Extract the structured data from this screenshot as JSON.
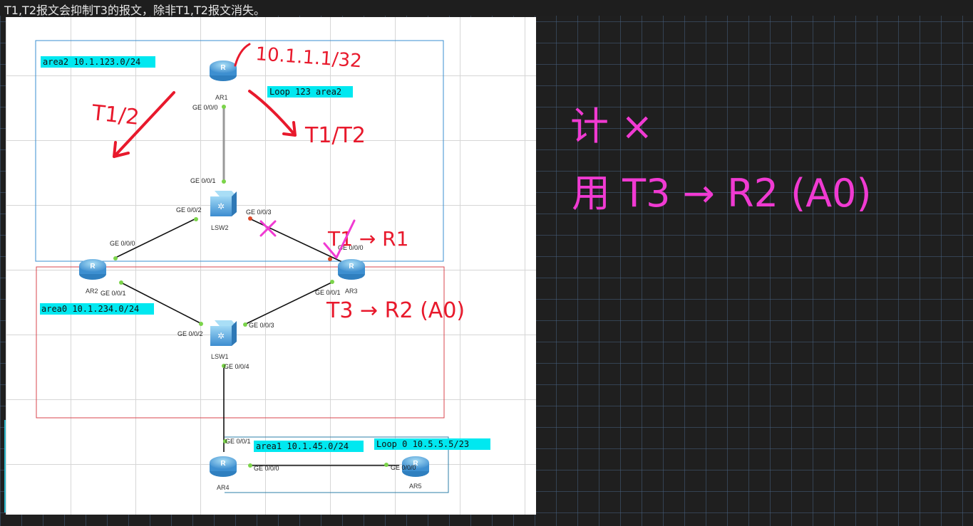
{
  "header": {
    "text": "T1,T2报文会抑制T3的报文，除非T1,T2报文消失。"
  },
  "areas": [
    {
      "id": "area2",
      "label": "area2 10.1.123.0/24",
      "color": "#3a8fd0"
    },
    {
      "id": "area0",
      "label": "area0 10.1.234.0/24",
      "color": "#d9444c"
    },
    {
      "id": "area1",
      "label": "area1 10.1.45.0/24",
      "color": "#2e7fa8"
    }
  ],
  "tags": {
    "loop123": "Loop 123 area2",
    "loop0": "Loop 0 10.5.5.5/23"
  },
  "devices": {
    "ar1": "AR1",
    "ar2": "AR2",
    "ar3": "AR3",
    "ar4": "AR4",
    "ar5": "AR5",
    "lsw1": "LSW1",
    "lsw2": "LSW2"
  },
  "ports": {
    "ar1_g000": "GE 0/0/0",
    "lsw2_g001": "GE 0/0/1",
    "lsw2_g002": "GE 0/0/2",
    "lsw2_g003": "GE 0/0/3",
    "ar2_g000": "GE 0/0/0",
    "ar2_g001": "GE 0/0/1",
    "ar3_g000": "GE 0/0/0",
    "ar3_g001": "GE 0/0/1",
    "lsw1_g002": "GE 0/0/2",
    "lsw1_g003": "GE 0/0/3",
    "lsw1_g004": "GE 0/0/4",
    "ar4_g001": "GE 0/0/1",
    "ar4_g000": "GE 0/0/0",
    "ar5_g000": "GE 0/0/0"
  },
  "annotations": {
    "red": {
      "ip": "10.1.1.1/32",
      "t12_left": "T1/2",
      "t12_right": "T1/T2",
      "t1_r1": "T1 → R1",
      "t3_r2": "T3 → R2 (A0)",
      "color": "#e8192c"
    },
    "pink": {
      "line1": "计 ×",
      "line2": "用 T3 → R2 (A0)",
      "color": "#f03ad2"
    }
  }
}
